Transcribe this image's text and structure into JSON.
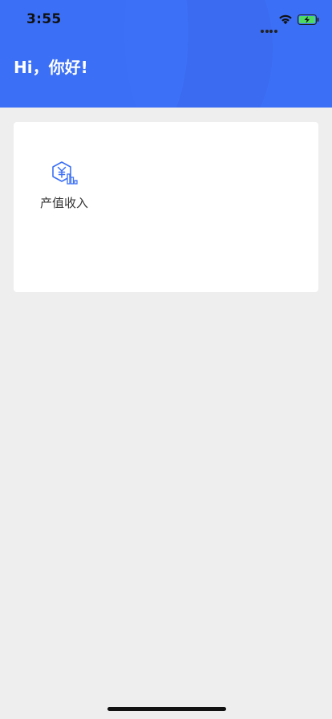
{
  "status_bar": {
    "time": "3:55",
    "icons": [
      "signal-dots-icon",
      "wifi-icon",
      "battery-charging-icon"
    ],
    "battery_color": "#4cd964"
  },
  "header": {
    "greeting": "Hi，你好!",
    "background_color": "#3b6ff6"
  },
  "card": {
    "items": [
      {
        "label": "产值收入",
        "icon": "yuan-chart-icon",
        "icon_color": "#3b6ff6"
      }
    ]
  }
}
